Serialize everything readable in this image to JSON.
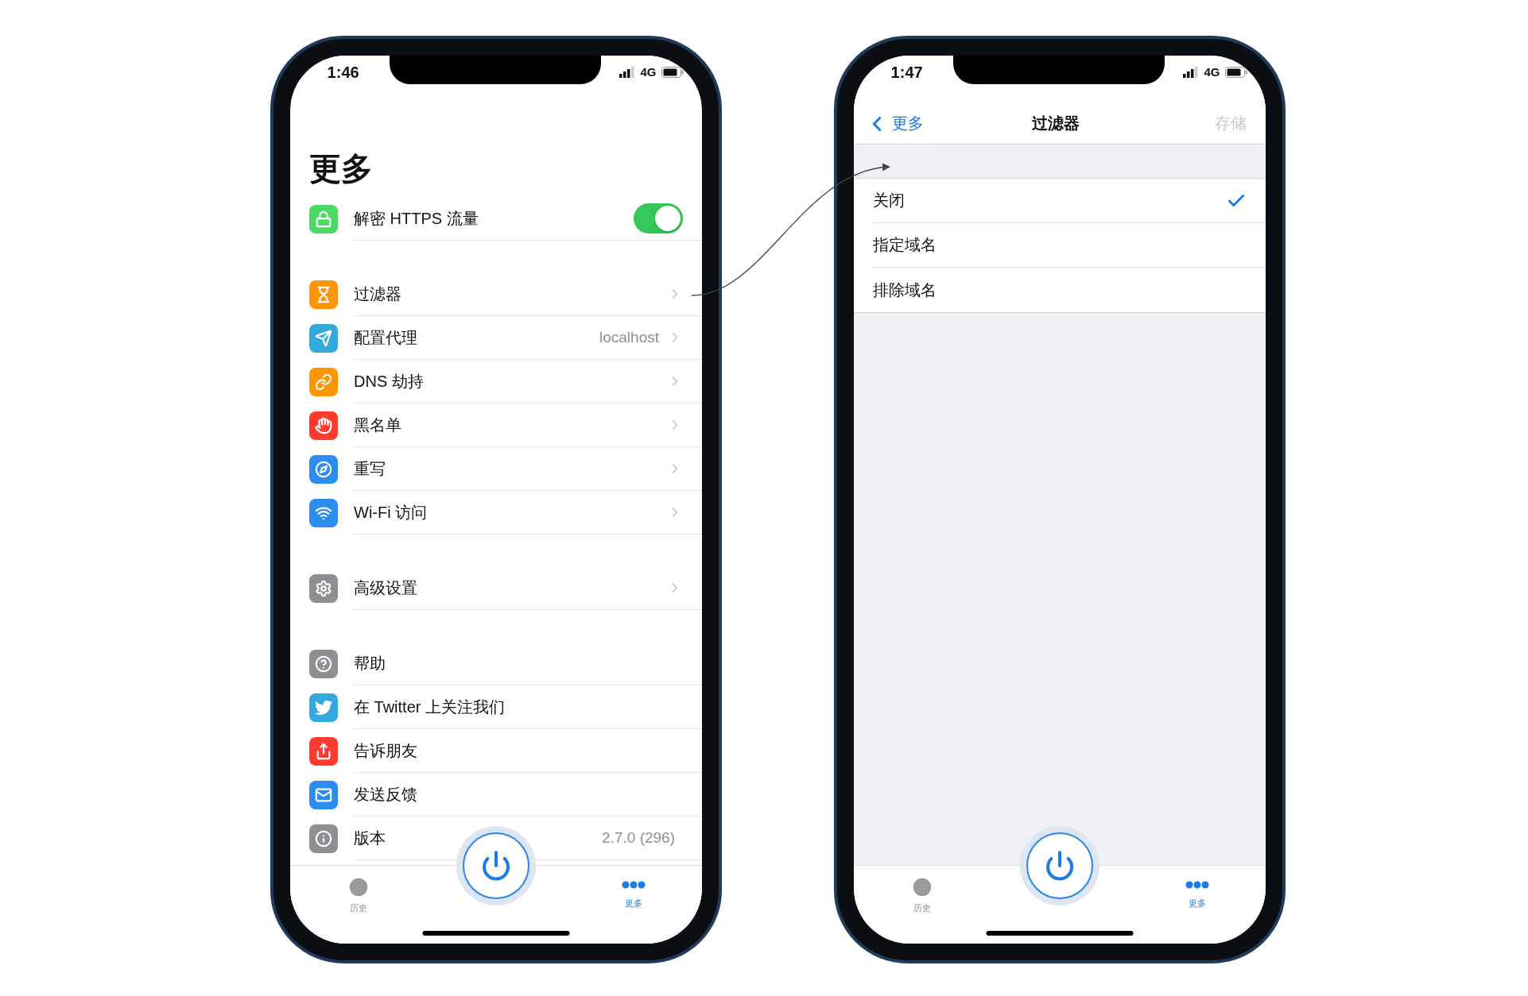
{
  "screens": [
    {
      "kind": "menu",
      "status_bar": {
        "time": "1:46",
        "network": "4G"
      },
      "title": "更多",
      "sections": [
        {
          "rows": [
            {
              "kind": "toggle",
              "label": "解密 HTTPS 流量",
              "color": "#4cd964",
              "on": true
            }
          ]
        },
        {
          "rows": [
            {
              "kind": "link",
              "label": "过滤器",
              "color": "#ff9500"
            },
            {
              "kind": "link",
              "label": "配置代理",
              "color": "#34aadc",
              "value": "localhost"
            },
            {
              "kind": "link",
              "label": "DNS 劫持",
              "color": "#ff9500"
            },
            {
              "kind": "link",
              "label": "黑名单",
              "color": "#ff3b30"
            },
            {
              "kind": "link",
              "label": "重写",
              "color": "#2d8cf0"
            },
            {
              "kind": "link",
              "label": "Wi-Fi 访问",
              "color": "#2d8cf0"
            }
          ]
        },
        {
          "rows": [
            {
              "kind": "link",
              "label": "高级设置",
              "color": "#8e8e93"
            }
          ]
        },
        {
          "rows": [
            {
              "kind": "action",
              "label": "帮助",
              "color": "#8e8e93"
            },
            {
              "kind": "action",
              "label": "在 Twitter 上关注我们",
              "color": "#34aadc"
            },
            {
              "kind": "action",
              "label": "告诉朋友",
              "color": "#ff3b30"
            },
            {
              "kind": "action",
              "label": "发送反馈",
              "color": "#2d8cf0"
            },
            {
              "kind": "action",
              "label": "版本",
              "color": "#8e8e93",
              "value": "2.7.0 (296)"
            }
          ]
        }
      ],
      "tabs": [
        {
          "label": "历史",
          "selected": false
        },
        {
          "label": "更多",
          "selected": true
        }
      ]
    },
    {
      "kind": "picker",
      "status_bar": {
        "time": "1:47",
        "network": "4G"
      },
      "nav": {
        "back": "更多",
        "title": "过滤器",
        "action": "存储",
        "action_disabled": true
      },
      "options": [
        {
          "label": "关闭",
          "selected": true
        },
        {
          "label": "指定域名",
          "selected": false
        },
        {
          "label": "排除域名",
          "selected": false
        }
      ],
      "tabs": [
        {
          "label": "历史",
          "selected": false
        },
        {
          "label": "更多",
          "selected": true
        }
      ]
    }
  ]
}
